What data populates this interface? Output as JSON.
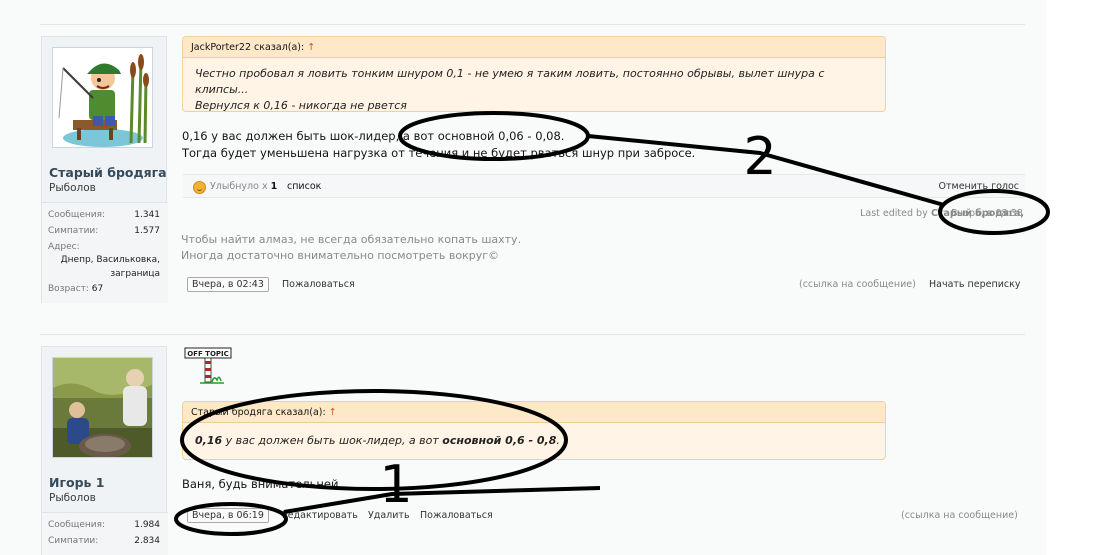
{
  "post1": {
    "user": {
      "name": "Старый бродяга",
      "title": "Рыболов",
      "stats": [
        {
          "label": "Сообщения:",
          "value": "1.341"
        },
        {
          "label": "Симпатии:",
          "value": "1.577"
        }
      ],
      "address_label": "Адрес:",
      "address_value": [
        "Днепр, Васильковка,",
        "заграница"
      ],
      "age_label": "Возраст:",
      "age_value": "67"
    },
    "quote": {
      "author": "JackPorter22 сказал(а):",
      "arrow": "↑",
      "lines": [
        "Честно пробовал я ловить тонким шнуром 0,1 - не умею я таким ловить, постоянно обрывы, вылет шнура с клипсы...",
        "Вернулся к 0,16 - никогда не рвется"
      ]
    },
    "text_lines": [
      "0,16 у вас должен быть шок-лидер, а вот основной 0,06 - 0,08.",
      "Тогда будет уменьшена нагрузка от течения и не будет рваться шнур при забросе."
    ],
    "likes": {
      "prefix": "Улыбнуло х",
      "count": "1",
      "list_label": "список",
      "unlike_label": "Отменить голос"
    },
    "edited": {
      "label": "Last edited by",
      "by": "Старый бродяга",
      "date": "Вчера, в 08:38"
    },
    "signature": [
      "Чтобы найти алмаз, не всегда обязательно копать шахту.",
      "Иногда достаточно внимательно посмотреть вокруг©"
    ],
    "footer": {
      "date": "Вчера, в 02:43",
      "report": "Пожаловаться",
      "permalink": "(ссылка на сообщение)",
      "start_convo": "Начать переписку"
    }
  },
  "post2": {
    "user": {
      "name": "Игорь 1",
      "title": "Рыболов",
      "stats": [
        {
          "label": "Сообщения:",
          "value": "1.984"
        },
        {
          "label": "Симпатии:",
          "value": "2.834"
        }
      ]
    },
    "offtopic": "OFF TOPIC",
    "quote": {
      "author": "Старый бродяга сказал(а):",
      "arrow": "↑",
      "bold1": "0,16",
      "mid": " у вас должен быть шок-лидер, а вот ",
      "bold2": "основной 0,6 - 0,8",
      "end": "."
    },
    "text": "Ваня, будь внимательней.",
    "footer": {
      "date": "Вчера, в 06:19",
      "edit": "Редактировать",
      "delete": "Удалить",
      "report": "Пожаловаться",
      "permalink": "(ссылка на сообщение)"
    }
  },
  "annotations": {
    "label1": "1",
    "label2": "2"
  }
}
